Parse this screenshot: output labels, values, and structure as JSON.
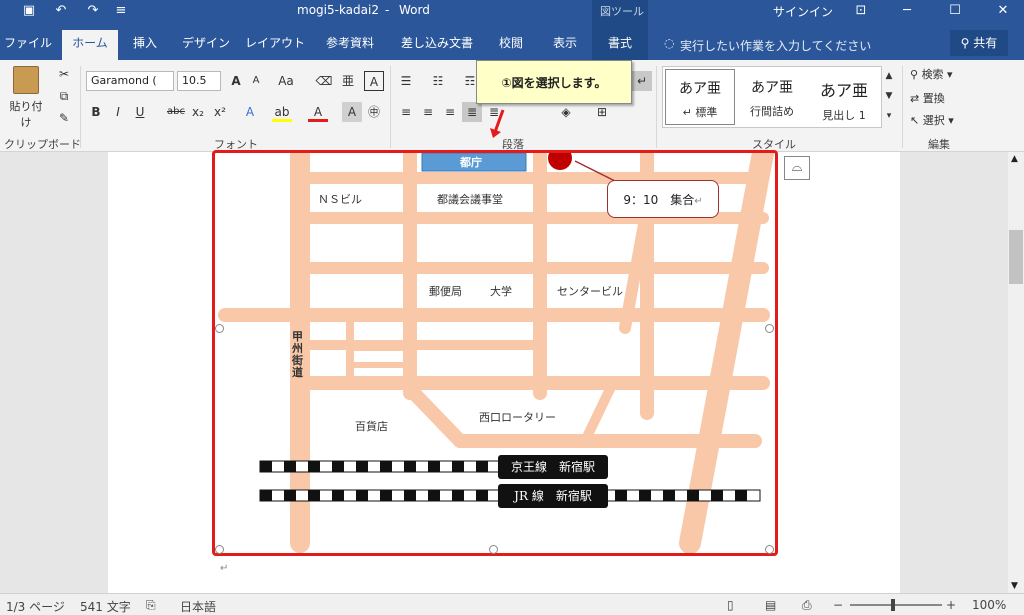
{
  "titlebar": {
    "doc_title": "mogi5-kadai2",
    "separator": "-",
    "app_name": "Word",
    "context_group": "図ツール",
    "signin": "サインイン"
  },
  "tabs": [
    "ファイル",
    "ホーム",
    "挿入",
    "デザイン",
    "レイアウト",
    "参考資料",
    "差し込み文書",
    "校閲",
    "表示",
    "書式"
  ],
  "tellme": "実行したい作業を入力してください",
  "share": "共有",
  "ribbon": {
    "clipboard": {
      "paste": "貼り付け",
      "title": "クリップボード"
    },
    "font": {
      "name": "Garamond (",
      "size": "10.5",
      "title": "フォント"
    },
    "paragraph": {
      "title": "段落"
    },
    "styles": {
      "title": "スタイル",
      "items": [
        {
          "sample": "あア亜",
          "label": "↵ 標準"
        },
        {
          "sample": "あア亜",
          "label": "行間詰め"
        },
        {
          "sample": "あア亜",
          "label": "見出し 1"
        }
      ]
    },
    "editing": {
      "title": "編集",
      "find": "検索",
      "replace": "置換",
      "select": "選択"
    }
  },
  "callout": "①図を選択します。",
  "map": {
    "city_hall": "都庁",
    "labels": {
      "ns_building": "ＮＳビル",
      "assembly": "都議会議事堂",
      "post_office": "郵便局",
      "university": "大学",
      "center_building": "センタービル",
      "koshu_kaido": "甲州街道",
      "department_store": "百貨店",
      "west_rotary": "西口ロータリー"
    },
    "keio_station": "京王線　新宿駅",
    "jr_station": "JR 線　新宿駅",
    "meet_text": "9：10　集合"
  },
  "statusbar": {
    "page": "1/3 ページ",
    "words": "541 文字",
    "language": "日本語",
    "zoom": "100%"
  },
  "colors": {
    "accent": "#2b579a",
    "road": "#f8c8a8",
    "frame": "#e31b1b",
    "marker": "#c00000"
  }
}
